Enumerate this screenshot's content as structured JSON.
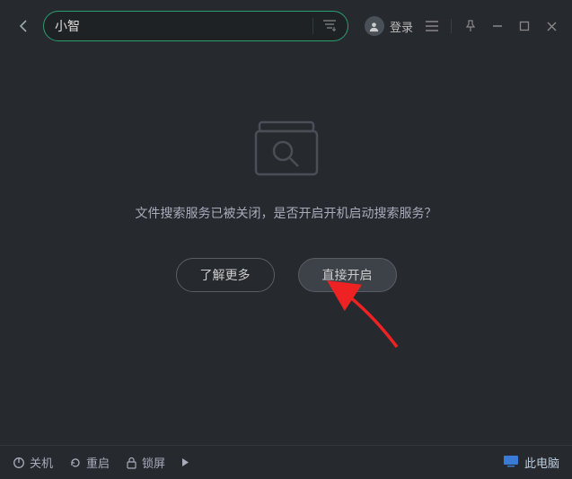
{
  "search": {
    "value": "小智",
    "placeholder": ""
  },
  "login": {
    "label": "登录"
  },
  "empty": {
    "message": "文件搜索服务已被关闭，是否开启开机启动搜索服务？",
    "learn_more": "了解更多",
    "enable_now": "直接开启"
  },
  "bottom": {
    "shutdown": "关机",
    "restart": "重启",
    "lock": "锁屏",
    "this_pc": "此电脑"
  }
}
